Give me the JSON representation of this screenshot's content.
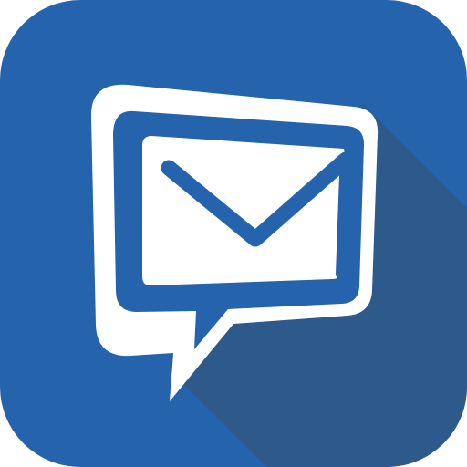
{
  "icon": {
    "name": "message-mail-app-icon",
    "glyph": "speech-bubble-envelope-icon"
  },
  "colors": {
    "background": "#2563ad",
    "long_shadow": "#2d5a8a",
    "bubble": "#ffffff",
    "envelope_outline": "#2563ad",
    "envelope_fill": "#ffffff"
  }
}
